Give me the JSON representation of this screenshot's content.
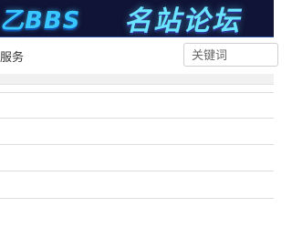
{
  "header": {
    "logo_left": "乙BBS",
    "logo_right": "名站论坛"
  },
  "nav": {
    "item_text": "服务"
  },
  "search": {
    "placeholder": "关键词"
  },
  "content": {
    "rows": [
      "",
      "",
      ""
    ]
  }
}
